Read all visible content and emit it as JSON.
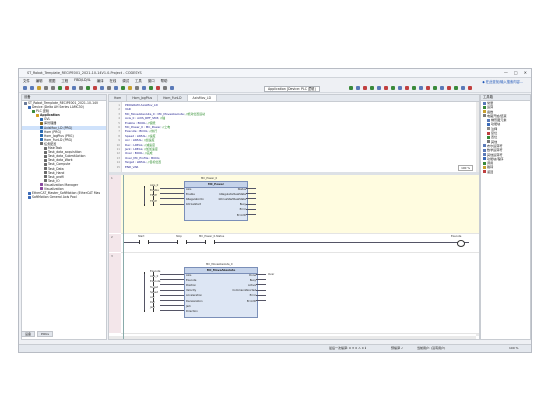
{
  "window": {
    "title": "ST_Robot_Template_RECIPE001_2021-10-14V1.0-Project - CODESYS",
    "controls": {
      "min": "—",
      "max": "□",
      "close": "✕"
    }
  },
  "menu": [
    "文件",
    "编辑",
    "视图",
    "工程",
    "FBD/LD/IL",
    "编译",
    "在线",
    "调试",
    "工具",
    "窗口",
    "帮助"
  ],
  "toolbar": {
    "app_field": "Application [Device: PLC 逻辑]"
  },
  "help_link": "◆ 在此查找/输入搜索内容...",
  "left_panel": {
    "title": "设备",
    "tree": [
      {
        "label": "ST_Robot_Template_RECIPE001_2021-10-14V",
        "level": 0,
        "color": "#6a7a9a"
      },
      {
        "label": "Device (Delta AH Series LAMC30)",
        "level": 1,
        "color": "#3a6ab8"
      },
      {
        "label": "PLC 逻辑",
        "level": 2,
        "color": "#3a8a3a"
      },
      {
        "label": "Application",
        "level": 3,
        "color": "#d4a020",
        "bold": true
      },
      {
        "label": "GVL",
        "level": 4,
        "color": "#2a6ab0"
      },
      {
        "label": "库管理器",
        "level": 4,
        "color": "#8a6a20"
      },
      {
        "label": "AxisMov_LD (PRG)",
        "level": 4,
        "color": "#2a6ab0"
      },
      {
        "label": "Hom (PRG)",
        "level": 4,
        "color": "#2a6ab0"
      },
      {
        "label": "Hom_JogPlus (PRG)",
        "level": 4,
        "color": "#2a6ab0"
      },
      {
        "label": "Hom_FunLD (PRG)",
        "level": 4,
        "color": "#2a6ab0"
      },
      {
        "label": "任务配置",
        "level": 4,
        "color": "#6a6a6a"
      },
      {
        "label": "MainTask",
        "level": 5,
        "color": "#6a6a6a"
      },
      {
        "label": "Task_data_acquisition",
        "level": 5,
        "color": "#6a6a6a"
      },
      {
        "label": "Task_data_SubmitAction",
        "level": 5,
        "color": "#6a6a6a"
      },
      {
        "label": "Task_data_Work",
        "level": 5,
        "color": "#6a6a6a"
      },
      {
        "label": "Task_Compute",
        "level": 5,
        "color": "#6a6a6a"
      },
      {
        "label": "Task_Data",
        "level": 5,
        "color": "#6a6a6a"
      },
      {
        "label": "Task_Hand",
        "level": 5,
        "color": "#6a6a6a"
      },
      {
        "label": "Task_profil",
        "level": 5,
        "color": "#6a6a6a"
      },
      {
        "label": "Task_IO",
        "level": 5,
        "color": "#6a6a6a"
      },
      {
        "label": "Visualization Manager",
        "level": 4,
        "color": "#8a4aa0"
      },
      {
        "label": "Visualization",
        "level": 4,
        "color": "#8a4aa0"
      },
      {
        "label": "EtherCAT_Master_SoftMotion (EtherCAT Mas",
        "level": 1,
        "color": "#3a6ab8"
      },
      {
        "label": "SoftMotion General Axis Pool",
        "level": 1,
        "color": "#3a6ab8"
      }
    ],
    "tabs": [
      "设备",
      "POUs"
    ]
  },
  "editor": {
    "tabs": [
      "Hom",
      "Hom_JogPlus",
      "Hom_FunLD",
      "AxisMov_LD"
    ],
    "active_tab": 3,
    "declarations": [
      {
        "code": "PROGRAM AxisMov_LD",
        "comment": ""
      },
      {
        "code": "VAR",
        "comment": ""
      },
      {
        "code": "  MC_MoveAbsolute_0 : MC_MoveAbsolute;",
        "comment": "//绝对位置运动"
      },
      {
        "code": "  Axis_0 : AXIS_REF_SM3;",
        "comment": "//轴"
      },
      {
        "code": "  Enable : BOOL;",
        "comment": "//使能"
      },
      {
        "code": "  MC_Power_0 : MC_Power;",
        "comment": "//上电"
      },
      {
        "code": "  Execute : BOOL;",
        "comment": "//执行"
      },
      {
        "code": "  Speed : LREAL;",
        "comment": "//速度"
      },
      {
        "code": "  Acc : LREAL;",
        "comment": "//加速度"
      },
      {
        "code": "  Dec : LREAL;",
        "comment": "//减速度"
      },
      {
        "code": "  Jerk : LREAL;",
        "comment": "//加加速度"
      },
      {
        "code": "  Over : BOOL;",
        "comment": "//完成"
      },
      {
        "code": "  Over_MC_Profile : BOOL;",
        "comment": ""
      },
      {
        "code": "  Target : LREAL;",
        "comment": "//目标位置"
      },
      {
        "code": "END_VAR",
        "comment": ""
      }
    ],
    "zoom": "100 %",
    "rungs": [
      {
        "number": "1",
        "fb_instance": "MC_Power_0",
        "fb_type": "MC_Power",
        "inputs": [
          "Axis",
          "Enable",
          "bRegulatorOn",
          "bDriveStart"
        ],
        "outputs": [
          "Status",
          "bRegulatorRealState",
          "bDriveStartRealState",
          "Busy",
          "Error",
          "ErrorID"
        ],
        "left_labels": [
          "Axis_0",
          "Enable",
          "TRUE",
          "TRUE"
        ]
      },
      {
        "number": "2",
        "contacts": [
          "Start",
          "Stop"
        ],
        "middle_label": "MC_Power_0.Status",
        "coil": "Execute"
      },
      {
        "number": "3",
        "fb_instance": "MC_MoveAbsolute_0",
        "fb_type": "MC_MoveAbsolute",
        "inputs": [
          "Axis",
          "Execute",
          "Position",
          "Velocity",
          "Acceleration",
          "Deceleration",
          "Jerk",
          "Direction"
        ],
        "outputs": [
          "Done",
          "Busy",
          "Active",
          "CommandAborted",
          "Error",
          "ErrorID"
        ],
        "left_labels": [
          "Execute",
          "Axis_0",
          "Execute",
          "Target",
          "Speed",
          "Acc",
          "Dec",
          "Jerk"
        ],
        "right_labels": [
          "Over"
        ]
      }
    ]
  },
  "right_panel": {
    "title": "工具箱",
    "items": [
      "常量",
      "运算",
      "函数",
      "电路开始/结束",
      "梯形图元素",
      "功能块",
      "注释",
      "复位",
      "置位",
      "其他",
      "布尔运算符",
      "数学运算符",
      "其他运算符",
      "功能块/程序",
      "调用",
      "跳转",
      "返回"
    ]
  },
  "status": {
    "left": "最后一次编译: 0 ✕ 0 ⚠ 0 ℹ",
    "precompile": "预编译 ✓",
    "user": "当前用户: (没有用户)",
    "right": "100 %"
  },
  "colors": {
    "accent": "#1c55b8",
    "selection": "#cfe2fb",
    "rung_highlight": "#fffce0",
    "fb_fill": "#dde6f4"
  }
}
